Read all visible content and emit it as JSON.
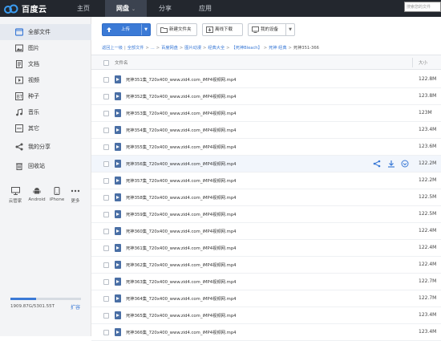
{
  "topbar": {
    "logo_text": "百度云",
    "nav": [
      {
        "label": "主页"
      },
      {
        "label": "网盘"
      },
      {
        "label": "分享"
      },
      {
        "label": "应用"
      }
    ],
    "nav_caret": "⌄",
    "search_placeholder": "搜索您的文件"
  },
  "sidebar": {
    "items": [
      {
        "label": "全部文件",
        "icon": "all-files-icon"
      },
      {
        "label": "图片",
        "icon": "image-icon"
      },
      {
        "label": "文档",
        "icon": "document-icon"
      },
      {
        "label": "视频",
        "icon": "video-icon"
      },
      {
        "label": "种子",
        "icon": "torrent-icon"
      },
      {
        "label": "音乐",
        "icon": "music-icon"
      },
      {
        "label": "其它",
        "icon": "other-icon"
      },
      {
        "label": "我的分享",
        "icon": "share-icon"
      },
      {
        "label": "回收站",
        "icon": "trash-icon"
      }
    ],
    "devices": [
      {
        "label": "云管家",
        "icon": "desktop-icon"
      },
      {
        "label": "Android",
        "icon": "android-icon"
      },
      {
        "label": "iPhone",
        "icon": "iphone-icon"
      },
      {
        "label": "更多",
        "icon": "more-icon"
      }
    ],
    "quota": {
      "text": "1909.87G/5301.55T",
      "fill_fraction": 0.36
    },
    "expand_label": "扩容"
  },
  "toolbar": {
    "upload_label": "上传",
    "new_folder_label": "新建文件夹",
    "offline_download_label": "离线下载",
    "my_devices_label": "我的设备"
  },
  "breadcrumb": {
    "back": "返回上一级",
    "all": "全部文件",
    "ellipsis": "...",
    "path": [
      "百度网盘",
      "图片动漫",
      "经典大全",
      "【死神Bleach】",
      "死神 经典"
    ],
    "current": "死神351-366"
  },
  "list_header": {
    "name_label": "文件名",
    "size_label": "大小"
  },
  "files": [
    {
      "name": "死神351集_720x400_www.zid4.com_iMP4视频网.mp4",
      "size": "122.8M"
    },
    {
      "name": "死神352集_720x400_www.zid4.com_iMP4视频网.mp4",
      "size": "123.8M"
    },
    {
      "name": "死神353集_720x400_www.zid4.com_iMP4视频网.mp4",
      "size": "123M"
    },
    {
      "name": "死神354集_720x400_www.zid4.com_iMP4视频网.mp4",
      "size": "123.4M"
    },
    {
      "name": "死神355集_720x400_www.zid4.com_iMP4视频网.mp4",
      "size": "123.6M"
    },
    {
      "name": "死神356集_720x400_www.zid4.com_iMP4视频网.mp4",
      "size": "122.2M"
    },
    {
      "name": "死神357集_720x400_www.zid4.com_iMP4视频网.mp4",
      "size": "122.2M"
    },
    {
      "name": "死神358集_720x400_www.zid4.com_iMP4视频网.mp4",
      "size": "122.5M"
    },
    {
      "name": "死神359集_720x400_www.zid4.com_iMP4视频网.mp4",
      "size": "122.5M"
    },
    {
      "name": "死神360集_720x400_www.zid4.com_iMP4视频网.mp4",
      "size": "122.4M"
    },
    {
      "name": "死神361集_720x400_www.zid4.com_iMP4视频网.mp4",
      "size": "122.4M"
    },
    {
      "name": "死神362集_720x400_www.zid4.com_iMP4视频网.mp4",
      "size": "122.4M"
    },
    {
      "name": "死神363集_720x400_www.zid4.com_iMP4视频网.mp4",
      "size": "122.7M"
    },
    {
      "name": "死神364集_720x400_www.zid4.com_iMP4视频网.mp4",
      "size": "122.7M"
    },
    {
      "name": "死神365集_720x400_www.zid4.com_iMP4视频网.mp4",
      "size": "123.4M"
    },
    {
      "name": "死神366集_720x400_www.zid4.com_iMP4视频网.mp4",
      "size": "123.4M"
    }
  ],
  "hover_row_actions": [
    "share-icon",
    "download-icon",
    "more-options-icon"
  ],
  "colors": {
    "topbar_bg": "#23272e",
    "accent": "#3b7ad6",
    "sidebar_bg": "#f3f4f6"
  }
}
